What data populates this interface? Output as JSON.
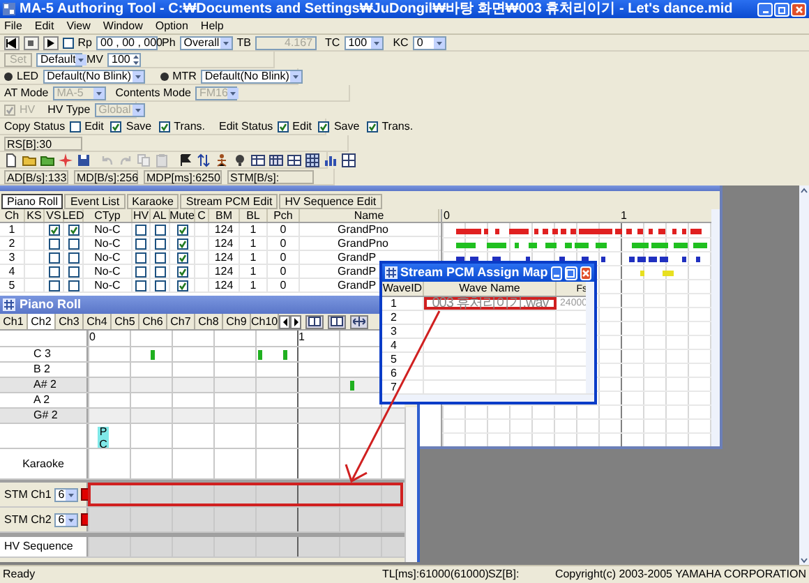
{
  "window": {
    "title": "MA-5 Authoring Tool - C:₩Documents and Settings₩JuDongil₩바탕 화면₩003 휴처리이기 - Let's dance.mid"
  },
  "menu": [
    "File",
    "Edit",
    "View",
    "Window",
    "Option",
    "Help"
  ],
  "playback": {
    "repeat": {
      "label": "Rp",
      "checked": false
    },
    "position": "00 , 00 , 000",
    "phrase": {
      "label": "Ph",
      "value": "Overall"
    },
    "tempo": {
      "label": "TB",
      "value": "4.167",
      "disabled": true
    },
    "tc": {
      "label": "TC",
      "value": "100"
    },
    "kc": {
      "label": "KC",
      "value": "0"
    }
  },
  "set_row": {
    "set": {
      "label": "Set",
      "disabled": true
    },
    "preset": "Default",
    "mv": {
      "label": "MV",
      "value": "100"
    }
  },
  "blink": [
    {
      "label": "LED",
      "value": "Default(No Blink)",
      "selected": true
    },
    {
      "label": "MTR",
      "value": "Default(No Blink)",
      "selected": true
    }
  ],
  "mode": [
    {
      "label": "AT Mode",
      "value": "MA-5",
      "disabled": true
    },
    {
      "label": "Contents Mode",
      "value": "FM16",
      "disabled": true
    }
  ],
  "hv": {
    "label": "HV",
    "checked": true,
    "disabled": true,
    "type_label": "HV Type",
    "type_value": "Global",
    "type_disabled": true
  },
  "status_groups": [
    {
      "label": "Copy Status",
      "options": [
        {
          "label": "Edit",
          "checked": false
        },
        {
          "label": "Save",
          "checked": true
        },
        {
          "label": "Trans.",
          "checked": true
        }
      ]
    },
    {
      "label": "Edit Status",
      "options": [
        {
          "label": "Edit",
          "checked": true
        },
        {
          "label": "Save",
          "checked": true
        },
        {
          "label": "Trans.",
          "checked": true
        }
      ]
    }
  ],
  "rs": "RS[B]:30",
  "meters": [
    "AD[B/s]:133",
    "MD[B/s]:256",
    "MDP[ms]:6250",
    "STM[B/s]:"
  ],
  "editor_tabs": [
    {
      "label": "Piano Roll",
      "selected": true
    },
    {
      "label": "Event List",
      "selected": false
    },
    {
      "label": "Karaoke",
      "selected": false
    },
    {
      "label": "Stream PCM Edit",
      "selected": false
    },
    {
      "label": "HV Sequence Edit",
      "selected": false
    }
  ],
  "channel_table": {
    "columns": [
      "Ch",
      "KS",
      "VS",
      "LED",
      "CTyp",
      "HV",
      "AL",
      "Mute",
      "C",
      "BM",
      "BL",
      "Pch",
      "Name"
    ],
    "rows": [
      {
        "ch": "1",
        "vs": true,
        "led": true,
        "ctyp": "No-C",
        "hv": false,
        "al": false,
        "mute": true,
        "bm": "124",
        "bl": "1",
        "pch": "0",
        "name": "GrandPno"
      },
      {
        "ch": "2",
        "vs": false,
        "led": false,
        "ctyp": "No-C",
        "hv": false,
        "al": false,
        "mute": true,
        "bm": "124",
        "bl": "1",
        "pch": "0",
        "name": "GrandPno"
      },
      {
        "ch": "3",
        "vs": false,
        "led": false,
        "ctyp": "No-C",
        "hv": false,
        "al": false,
        "mute": true,
        "bm": "124",
        "bl": "1",
        "pch": "0",
        "name": "GrandP"
      },
      {
        "ch": "4",
        "vs": false,
        "led": false,
        "ctyp": "No-C",
        "hv": false,
        "al": false,
        "mute": true,
        "bm": "124",
        "bl": "1",
        "pch": "0",
        "name": "GrandP"
      },
      {
        "ch": "5",
        "vs": false,
        "led": false,
        "ctyp": "No-C",
        "hv": false,
        "al": false,
        "mute": true,
        "bm": "124",
        "bl": "1",
        "pch": "0",
        "name": "GrandP"
      }
    ],
    "timeline": [
      "0",
      "1"
    ]
  },
  "pcm_map": {
    "title": "Stream PCM Assign Map",
    "columns": [
      "WaveID",
      "Wave Name",
      "Fs"
    ],
    "rows": [
      {
        "id": "1",
        "wave": "003 휴처리이기.wav",
        "fs": "24000",
        "highlighted": true
      },
      {
        "id": "2",
        "highlighted": false
      },
      {
        "id": "3",
        "highlighted": false
      },
      {
        "id": "4",
        "highlighted": false
      },
      {
        "id": "5",
        "highlighted": false
      },
      {
        "id": "6",
        "highlighted": false
      },
      {
        "id": "7",
        "highlighted": false
      }
    ]
  },
  "piano_roll": {
    "title": "Piano Roll",
    "channel_tabs": [
      {
        "label": "Ch1",
        "selected": false
      },
      {
        "label": "Ch2",
        "selected": true
      },
      {
        "label": "Ch3",
        "selected": false
      },
      {
        "label": "Ch4",
        "selected": false
      },
      {
        "label": "Ch5",
        "selected": false
      },
      {
        "label": "Ch6",
        "selected": false
      },
      {
        "label": "Ch7",
        "selected": false
      },
      {
        "label": "Ch8",
        "selected": false
      },
      {
        "label": "Ch9",
        "selected": false
      },
      {
        "label": "Ch10",
        "selected": false
      }
    ],
    "timeline": [
      "0",
      "1"
    ],
    "keys": [
      {
        "label": "C 3",
        "black": false
      },
      {
        "label": "B 2",
        "black": false
      },
      {
        "label": "A# 2",
        "black": true
      },
      {
        "label": "A 2",
        "black": false
      },
      {
        "label": "G# 2",
        "black": true
      }
    ],
    "marker": "PC",
    "karaoke": "Karaoke",
    "stm_channels": [
      {
        "label": "STM Ch1",
        "value": "6",
        "highlighted": true
      },
      {
        "label": "STM Ch2",
        "value": "6",
        "highlighted": false
      }
    ],
    "hv_sequence": "HV Sequence"
  },
  "status_bar": [
    "Ready",
    "TL[ms]:61000(61000)",
    "SZ[B]:",
    "Copyright(c) 2003-2005 YAMAHA CORPORATION"
  ]
}
